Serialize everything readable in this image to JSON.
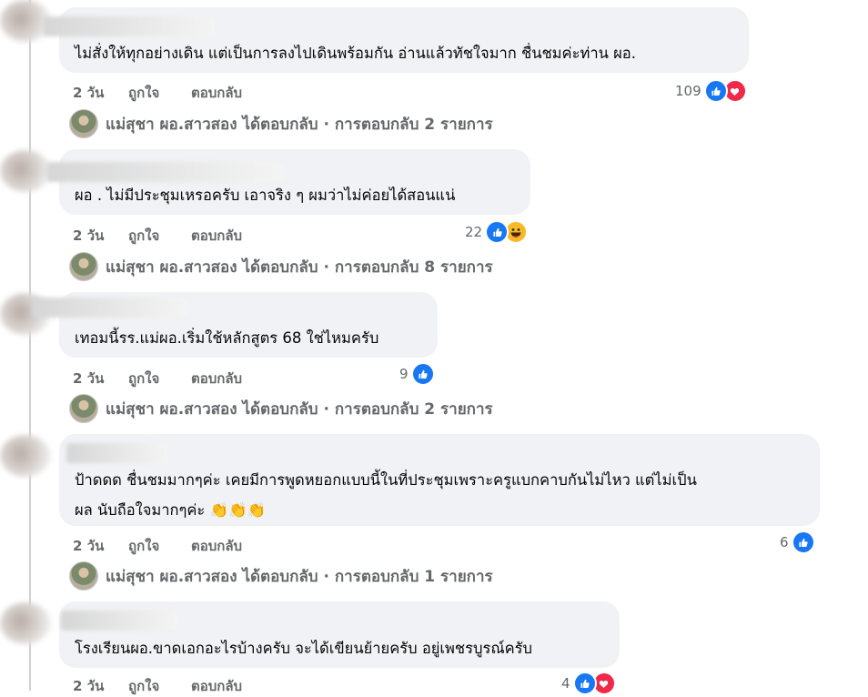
{
  "colors": {
    "bubble": "#f0f2f5",
    "secondary_text": "#65676b",
    "like": "#1877f2",
    "love": "#f02849",
    "haha": "#f7b928"
  },
  "actions": {
    "like_label": "ถูกใจ",
    "reply_label": "ตอบกลับ"
  },
  "comments": [
    {
      "text": "ไม่สั่งให้ทุกอย่างเดิน แต่เป็นการลงไปเดินพร้อมกัน อ่านแล้วทัชใจมาก ชื่นชมค่ะท่าน ผอ.",
      "time": "2 วัน",
      "reaction_count": "109",
      "reaction_icons": [
        "like-icon",
        "love-icon"
      ],
      "reply_summary": "แม่สุชา ผอ.สาวสอง ได้ตอบกลับ · การตอบกลับ 2 รายการ"
    },
    {
      "text": "ผอ . ไม่มีประชุมเหรอครับ เอาจริง ๆ ผมว่าไม่ค่อยได้สอนแน่",
      "time": "2 วัน",
      "reaction_count": "22",
      "reaction_icons": [
        "like-icon",
        "haha-icon"
      ],
      "reply_summary": "แม่สุชา ผอ.สาวสอง ได้ตอบกลับ · การตอบกลับ 8 รายการ"
    },
    {
      "text": "เทอมนี้รร.แม่ผอ.เริ่มใช้หลักสูตร 68 ใช่ไหมครับ",
      "time": "2 วัน",
      "reaction_count": "9",
      "reaction_icons": [
        "like-icon"
      ],
      "reply_summary": "แม่สุชา ผอ.สาวสอง ได้ตอบกลับ · การตอบกลับ 2 รายการ"
    },
    {
      "text_line1": "ป้าดดด ชื่นชมมากๆค่ะ เคยมีการพูดหยอกแบบนี้ในที่ประชุมเพราะครูแบกคาบกันไม่ไหว แต่ไม่เป็น",
      "text_line2": "ผล นับถือใจมากๆค่ะ 👏👏👏",
      "time": "2 วัน",
      "reaction_count": "6",
      "reaction_icons": [
        "like-icon"
      ],
      "reply_summary": "แม่สุชา ผอ.สาวสอง ได้ตอบกลับ · การตอบกลับ 1 รายการ"
    },
    {
      "text": "โรงเรียนผอ.ขาดเอกอะไรบ้างครับ จะได้เขียนย้ายครับ อยู่เพชรบูรณ์ครับ",
      "time": "2 วัน",
      "reaction_count": "4",
      "reaction_icons": [
        "like-icon",
        "love-icon"
      ]
    }
  ]
}
